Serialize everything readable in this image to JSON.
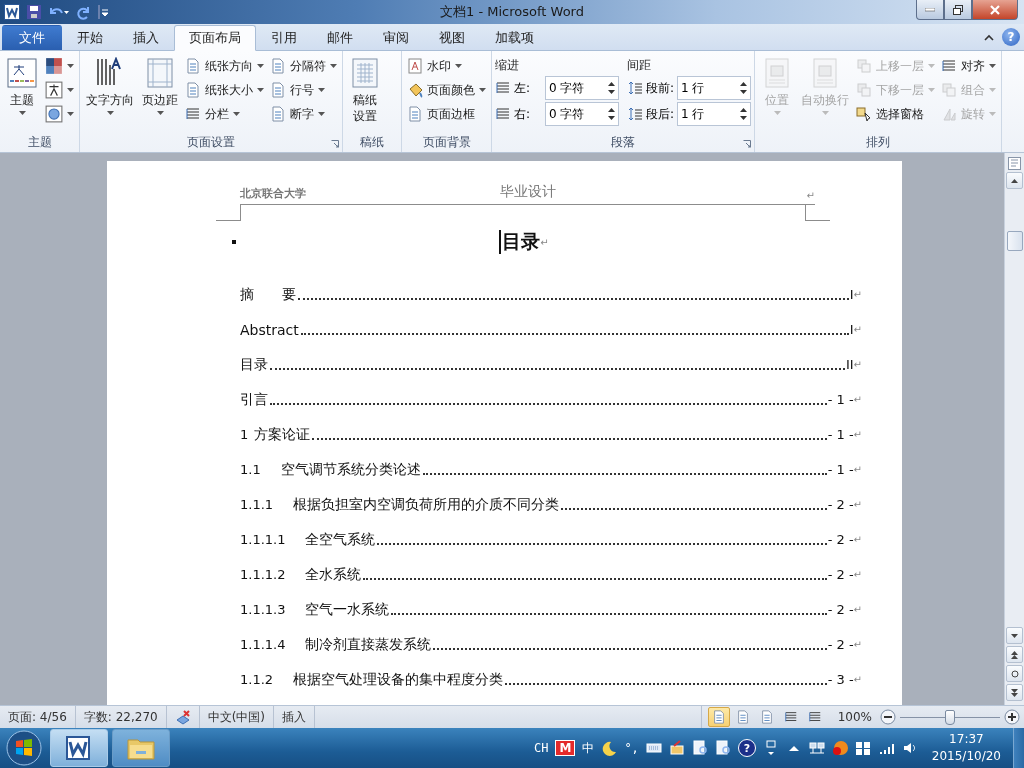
{
  "title_bar": {
    "title": "文档1  -  Microsoft Word"
  },
  "tabs": [
    {
      "label": "文件",
      "kind": "file",
      "selected": false
    },
    {
      "label": "开始",
      "kind": "tab",
      "selected": false
    },
    {
      "label": "插入",
      "kind": "tab",
      "selected": false
    },
    {
      "label": "页面布局",
      "kind": "tab",
      "selected": true
    },
    {
      "label": "引用",
      "kind": "tab",
      "selected": false
    },
    {
      "label": "邮件",
      "kind": "tab",
      "selected": false
    },
    {
      "label": "审阅",
      "kind": "tab",
      "selected": false
    },
    {
      "label": "视图",
      "kind": "tab",
      "selected": false
    },
    {
      "label": "加载项",
      "kind": "tab",
      "selected": false
    }
  ],
  "help": "?",
  "ribbon": {
    "groups": [
      {
        "label": "主题",
        "launcher": false,
        "columns": [
          [
            {
              "kind": "large",
              "label": "主题",
              "dropdown": true,
              "disabled": false
            }
          ],
          [
            {
              "kind": "icon",
              "dropdown": true,
              "disabled": false
            },
            {
              "kind": "icon",
              "dropdown": true,
              "disabled": false
            },
            {
              "kind": "icon",
              "dropdown": true,
              "disabled": false
            }
          ]
        ]
      },
      {
        "label": "页面设置",
        "launcher": true,
        "columns": [
          [
            {
              "kind": "large",
              "label": "文字方向",
              "dropdown": true,
              "disabled": false
            }
          ],
          [
            {
              "kind": "large",
              "label": "页边距",
              "dropdown": true,
              "disabled": false
            }
          ],
          [
            {
              "kind": "small",
              "label": "纸张方向",
              "dropdown": true,
              "disabled": false
            },
            {
              "kind": "small",
              "label": "纸张大小",
              "dropdown": true,
              "disabled": false
            },
            {
              "kind": "small",
              "label": "分栏",
              "dropdown": true,
              "disabled": false
            }
          ],
          [
            {
              "kind": "small",
              "label": "分隔符",
              "dropdown": true,
              "disabled": false
            },
            {
              "kind": "small",
              "label": "行号",
              "dropdown": true,
              "disabled": false
            },
            {
              "kind": "small",
              "label": "断字",
              "dropdown": true,
              "disabled": false
            }
          ]
        ]
      },
      {
        "label": "稿纸",
        "launcher": false,
        "columns": [
          [
            {
              "kind": "large",
              "label": "稿纸设置",
              "dropdown": false,
              "disabled": false
            }
          ]
        ]
      },
      {
        "label": "页面背景",
        "launcher": false,
        "columns": [
          [
            {
              "kind": "small",
              "label": "水印",
              "dropdown": true,
              "disabled": false
            },
            {
              "kind": "small",
              "label": "页面颜色",
              "dropdown": true,
              "disabled": false
            },
            {
              "kind": "small",
              "label": "页面边框",
              "dropdown": false,
              "disabled": false
            }
          ]
        ]
      },
      {
        "label": "段落",
        "launcher": true,
        "columns": [
          [
            {
              "kind": "header",
              "label": "缩进"
            },
            {
              "kind": "spin",
              "label": "左:",
              "value": "0 字符"
            },
            {
              "kind": "spin",
              "label": "右:",
              "value": "0 字符"
            }
          ],
          [
            {
              "kind": "header",
              "label": "间距"
            },
            {
              "kind": "spin",
              "label": "段前:",
              "value": "1 行"
            },
            {
              "kind": "spin",
              "label": "段后:",
              "value": "1 行"
            }
          ]
        ]
      },
      {
        "label": "排列",
        "launcher": false,
        "columns": [
          [
            {
              "kind": "large",
              "label": "位置",
              "dropdown": true,
              "disabled": true
            }
          ],
          [
            {
              "kind": "large",
              "label": "自动换行",
              "dropdown": true,
              "disabled": true
            }
          ],
          [
            {
              "kind": "small",
              "label": "上移一层",
              "dropdown": true,
              "disabled": true
            },
            {
              "kind": "small",
              "label": "下移一层",
              "dropdown": true,
              "disabled": true
            },
            {
              "kind": "small",
              "label": "选择窗格",
              "dropdown": false,
              "disabled": false
            }
          ],
          [
            {
              "kind": "small",
              "label": "对齐",
              "dropdown": true,
              "disabled": false
            },
            {
              "kind": "small",
              "label": "组合",
              "dropdown": true,
              "disabled": true
            },
            {
              "kind": "small",
              "label": "旋转",
              "dropdown": true,
              "disabled": true
            }
          ]
        ]
      }
    ]
  },
  "document": {
    "header": {
      "left": "北京联合大学",
      "center": "毕业设计",
      "mark": "↵"
    },
    "heading": {
      "text": "目录",
      "mark": "↵"
    },
    "toc": [
      {
        "title": "摘　　要",
        "page": "I",
        "mark": "↵"
      },
      {
        "title": "Abstract",
        "page": "I",
        "mark": "↵"
      },
      {
        "title": "目录",
        "page": "II",
        "mark": "↵"
      },
      {
        "title": "引言",
        "page": "- 1 -",
        "mark": "↵"
      },
      {
        "number": "1",
        "title": "方案论证",
        "page": "- 1 -",
        "mark": "↵"
      },
      {
        "number": "1.1",
        "title": "空气调节系统分类论述",
        "page": "- 1 -",
        "mark": "↵"
      },
      {
        "number": "1.1.1",
        "title": "根据负担室内空调负荷所用的介质不同分类",
        "page": "- 2 -",
        "mark": "↵"
      },
      {
        "number": "1.1.1.1",
        "title": "全空气系统",
        "page": "- 2 -",
        "mark": "↵"
      },
      {
        "number": "1.1.1.2",
        "title": "全水系统",
        "page": "- 2 -",
        "mark": "↵"
      },
      {
        "number": "1.1.1.3",
        "title": "空气一水系统",
        "page": "- 2 -",
        "mark": "↵"
      },
      {
        "number": "1.1.1.4",
        "title": "制冷剂直接蒸发系统",
        "page": "- 2 -",
        "mark": "↵"
      },
      {
        "number": "1.1.2",
        "title": "根据空气处理设备的集中程度分类",
        "page": "- 3 -",
        "mark": "↵"
      }
    ]
  },
  "status_bar": {
    "items": [
      {
        "kind": "text",
        "text": "页面: 4/56"
      },
      {
        "kind": "text",
        "text": "字数: 22,270"
      },
      {
        "kind": "icon"
      },
      {
        "kind": "text",
        "text": "中文(中国)"
      },
      {
        "kind": "text",
        "text": "插入"
      }
    ],
    "views": [
      {
        "selected": true
      },
      {
        "selected": false
      },
      {
        "selected": false
      },
      {
        "selected": false
      },
      {
        "selected": false
      }
    ],
    "zoom": "100%",
    "zoom_slider": {
      "level": 0.5
    }
  },
  "taskbar": {
    "apps": [
      {
        "selected": true
      },
      {
        "selected": false
      }
    ],
    "tray": [
      {
        "kind": "text",
        "text": "CH"
      },
      {
        "kind": "logo",
        "text": "M"
      },
      {
        "kind": "text",
        "text": "中"
      },
      {
        "kind": "icon"
      },
      {
        "kind": "text",
        "text": "°,"
      },
      {
        "kind": "icon"
      },
      {
        "kind": "icon"
      },
      {
        "kind": "icon"
      },
      {
        "kind": "icon"
      },
      {
        "kind": "help",
        "text": "?"
      },
      {
        "kind": "icon"
      },
      {
        "kind": "icon"
      },
      {
        "kind": "icon"
      },
      {
        "kind": "icon"
      },
      {
        "kind": "icon"
      },
      {
        "kind": "icon"
      },
      {
        "kind": "icon"
      }
    ],
    "time": "17:37",
    "date": "2015/10/20"
  }
}
